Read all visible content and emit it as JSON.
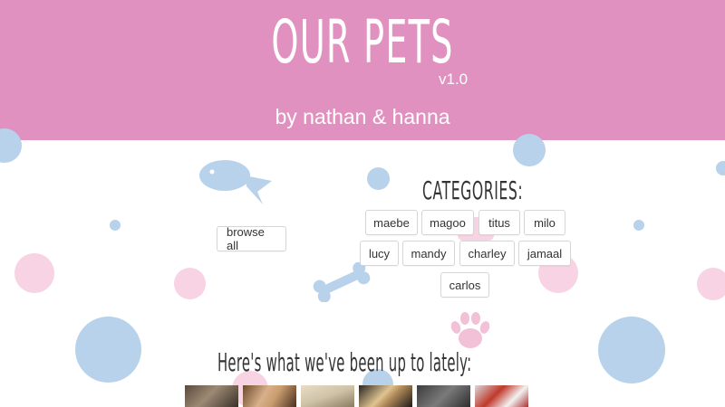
{
  "header": {
    "title": "OUR PETS",
    "version": "v1.0",
    "byline": "by nathan & hanna",
    "background_color": "#e191bf"
  },
  "browse": {
    "label": "browse all"
  },
  "categories": {
    "heading": "CATEGORIES:",
    "items": [
      "maebe",
      "magoo",
      "titus",
      "milo",
      "lucy",
      "mandy",
      "charley",
      "jamaal",
      "carlos"
    ]
  },
  "recent": {
    "heading": "Here's what we've been up to lately:",
    "thumbnails": [
      "dog-photo",
      "person-photo",
      "dog-photo",
      "person-photo",
      "cat-photo",
      "pet-photo"
    ]
  },
  "decorations": {
    "icons": [
      "fish-icon",
      "bone-icon",
      "paw-icon"
    ],
    "colors": {
      "blue": "#b7d2ea",
      "pink": "#f7d3e3"
    }
  }
}
